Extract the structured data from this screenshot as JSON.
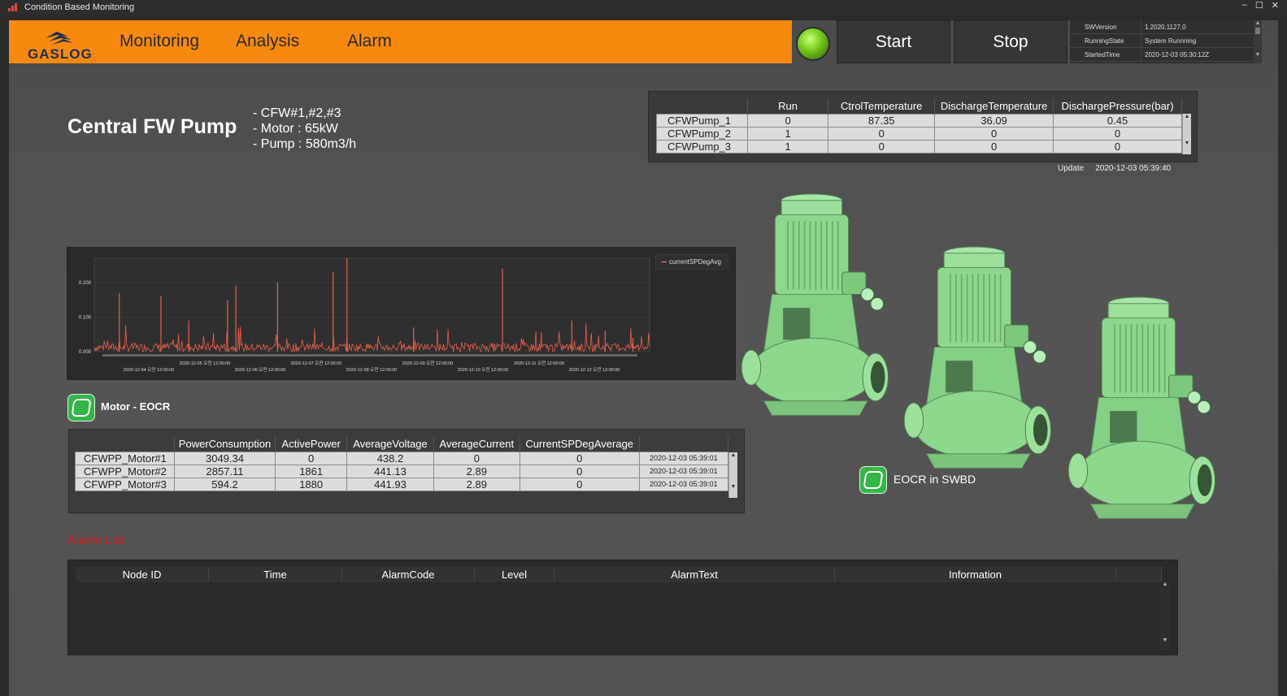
{
  "window": {
    "title": "Condition Based Monitoring",
    "controls": [
      "–",
      "☐",
      "✕"
    ]
  },
  "nav": {
    "logo_text": "GASLOG",
    "items": [
      "Monitoring",
      "Analysis",
      "Alarm"
    ]
  },
  "controls": {
    "start_label": "Start",
    "stop_label": "Stop",
    "status_color": "#7ccc22"
  },
  "info": {
    "rows": [
      {
        "key": "SWVersion",
        "value": "1.2020.1127.0"
      },
      {
        "key": "RunningState",
        "value": "System Runnning"
      },
      {
        "key": "StartedTime",
        "value": "2020-12-03 05:30:12Z"
      }
    ]
  },
  "equipment": {
    "title": "Central FW Pump",
    "specs": [
      "- CFW#1,#2,#3",
      "- Motor : 65kW",
      "- Pump : 580m3/h"
    ]
  },
  "pump_table": {
    "columns": [
      "",
      "Run",
      "CtrolTemperature",
      "DischargeTemperature",
      "DischargePressure(bar)"
    ],
    "rows": [
      [
        "CFWPump_1",
        "0",
        "87.35",
        "36.09",
        "0.45"
      ],
      [
        "CFWPump_2",
        "1",
        "0",
        "0",
        "0"
      ],
      [
        "CFWPump_3",
        "1",
        "0",
        "0",
        "0"
      ]
    ],
    "update_label": "Update",
    "update_time": "2020-12-03 05:39:40"
  },
  "chart_data": {
    "type": "line",
    "series": [
      {
        "name": "currentSPDegAvg",
        "color": "#e8604a"
      }
    ],
    "yticks": [
      "0.200",
      "0.100",
      "0.000"
    ],
    "ylim": [
      0,
      0.27
    ],
    "xticks_top": [
      "2020-12-05 오전 12:00:00",
      "2020-12-07 오전 12:00:00",
      "2020-12-09 오전 12:00:00",
      "2020-12-11 오전 12:00:00"
    ],
    "xticks_bottom": [
      "2020-12-04 오전 12:00:00",
      "2020-12-06 오전 12:00:00",
      "2020-12-08 오전 12:00:00",
      "2020-12-10 오전 12:00:00",
      "2020-12-12 오전 12:00:00"
    ],
    "spikes": [
      [
        0.045,
        0.17
      ],
      [
        0.12,
        0.16
      ],
      [
        0.17,
        0.09
      ],
      [
        0.24,
        0.15
      ],
      [
        0.255,
        0.19
      ],
      [
        0.33,
        0.2
      ],
      [
        0.43,
        0.23
      ],
      [
        0.455,
        0.27
      ],
      [
        0.575,
        0.07
      ],
      [
        0.735,
        0.24
      ],
      [
        0.86,
        0.09
      ],
      [
        0.92,
        0.06
      ],
      [
        0.97,
        0.04
      ]
    ]
  },
  "motor": {
    "label": "Motor - EOCR",
    "columns": [
      "",
      "PowerConsumption",
      "ActivePower",
      "AverageVoltage",
      "AverageCurrent",
      "CurrentSPDegAverage",
      ""
    ],
    "rows": [
      [
        "CFWPP_Motor#1",
        "3049.34",
        "0",
        "438.2",
        "0",
        "0",
        "2020-12-03 05:39:01"
      ],
      [
        "CFWPP_Motor#2",
        "2857.11",
        "1861",
        "441.13",
        "2.89",
        "0",
        "2020-12-03 05:39:01"
      ],
      [
        "CFWPP_Motor#3",
        "594.2",
        "1880",
        "441.93",
        "2.89",
        "0",
        "2020-12-03 05:39:01"
      ]
    ]
  },
  "eocr": {
    "label": "EOCR in SWBD"
  },
  "alarm": {
    "title": "Alarm List",
    "columns": [
      "Node ID",
      "Time",
      "AlarmCode",
      "Level",
      "AlarmText",
      "Information"
    ]
  },
  "colors": {
    "accent": "#f7890e",
    "alarm_title": "#d91f1f",
    "eocr_icon": "#35b548",
    "pump_body": "#8ed88e"
  }
}
